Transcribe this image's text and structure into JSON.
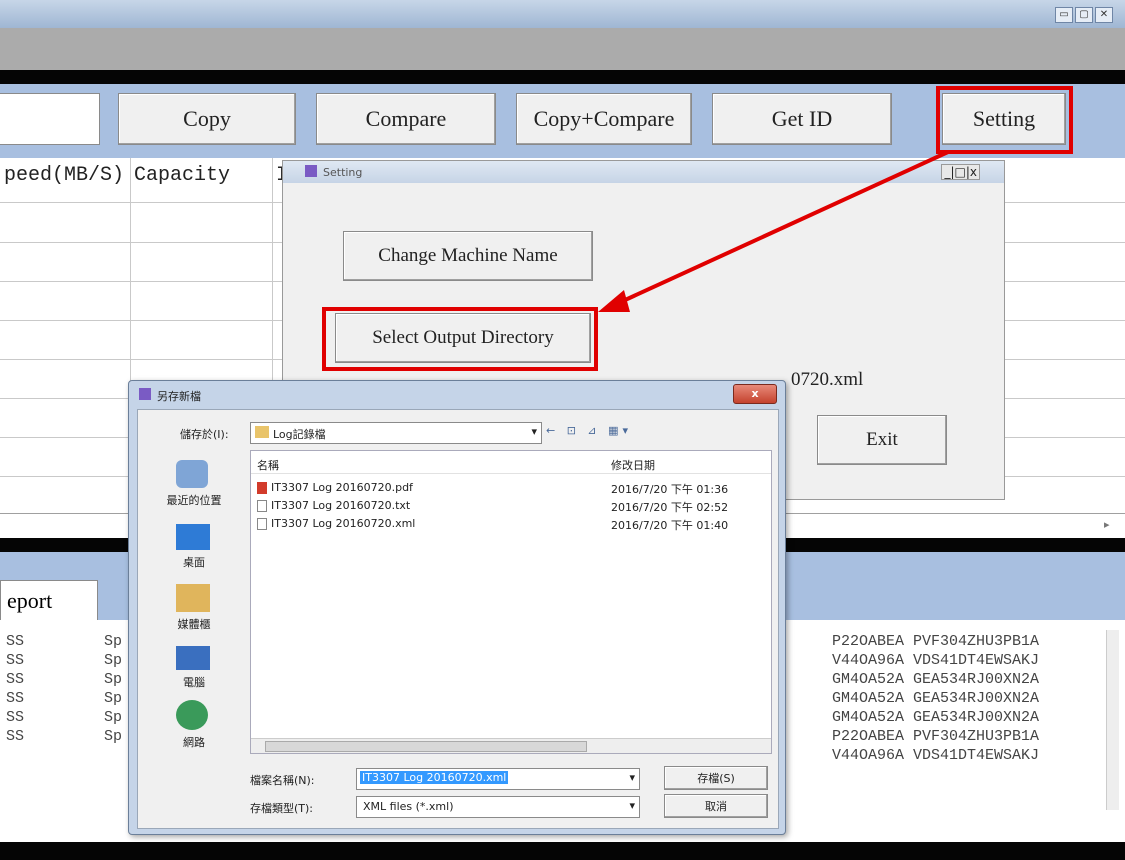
{
  "window": {
    "controls": [
      "▭",
      "▢",
      "✕"
    ]
  },
  "toolbar": {
    "copy": "Copy",
    "compare": "Compare",
    "copy_compare": "Copy+Compare",
    "get_id": "Get ID",
    "setting": "Setting"
  },
  "grid": {
    "col_speed": "peed(MB/S)",
    "col_capacity": "Capacity",
    "col_partial": "I"
  },
  "report_tab": "eport",
  "log": {
    "left_rows": [
      "SS",
      "SS",
      "SS",
      "SS",
      "SS",
      "SS"
    ],
    "mid_rows": [
      "Sp",
      "Sp",
      "Sp",
      "Sp",
      "Sp",
      "Sp"
    ],
    "right_rows": [
      "P22OABEA PVF304ZHU3PB1A",
      "V44OA96A VDS41DT4EWSAKJ",
      "GM4OA52A GEA534RJ00XN2A",
      "GM4OA52A GEA534RJ00XN2A",
      "GM4OA52A GEA534RJ00XN2A",
      "P22OABEA PVF304ZHU3PB1A",
      "V44OA96A VDS41DT4EWSAKJ"
    ]
  },
  "setting_dialog": {
    "title": "Setting",
    "controls": "_|□|x",
    "change_machine_name": "Change Machine Name",
    "select_output_directory": "Select Output Directory",
    "path_suffix": "0720.xml",
    "exit": "Exit"
  },
  "save_dialog": {
    "title": "另存新檔",
    "save_in_label": "儲存於(I):",
    "save_in_value": "Log記錄檔",
    "col_name": "名稱",
    "col_date": "修改日期",
    "files": [
      {
        "name": "IT3307 Log 20160720.pdf",
        "date": "2016/7/20 下午 01:36"
      },
      {
        "name": "IT3307 Log 20160720.txt",
        "date": "2016/7/20 下午 02:52"
      },
      {
        "name": "IT3307 Log 20160720.xml",
        "date": "2016/7/20 下午 01:40"
      }
    ],
    "places": [
      "最近的位置",
      "桌面",
      "媒體櫃",
      "電腦",
      "網路"
    ],
    "filename_label": "檔案名稱(N):",
    "filename_value": "IT3307 Log 20160720.xml",
    "filetype_label": "存檔類型(T):",
    "filetype_value": "XML files (*.xml)",
    "save_button": "存檔(S)",
    "cancel_button": "取消",
    "close_button": "x",
    "colors": {
      "highlight": "#3399ff",
      "red": "#e00000"
    }
  }
}
